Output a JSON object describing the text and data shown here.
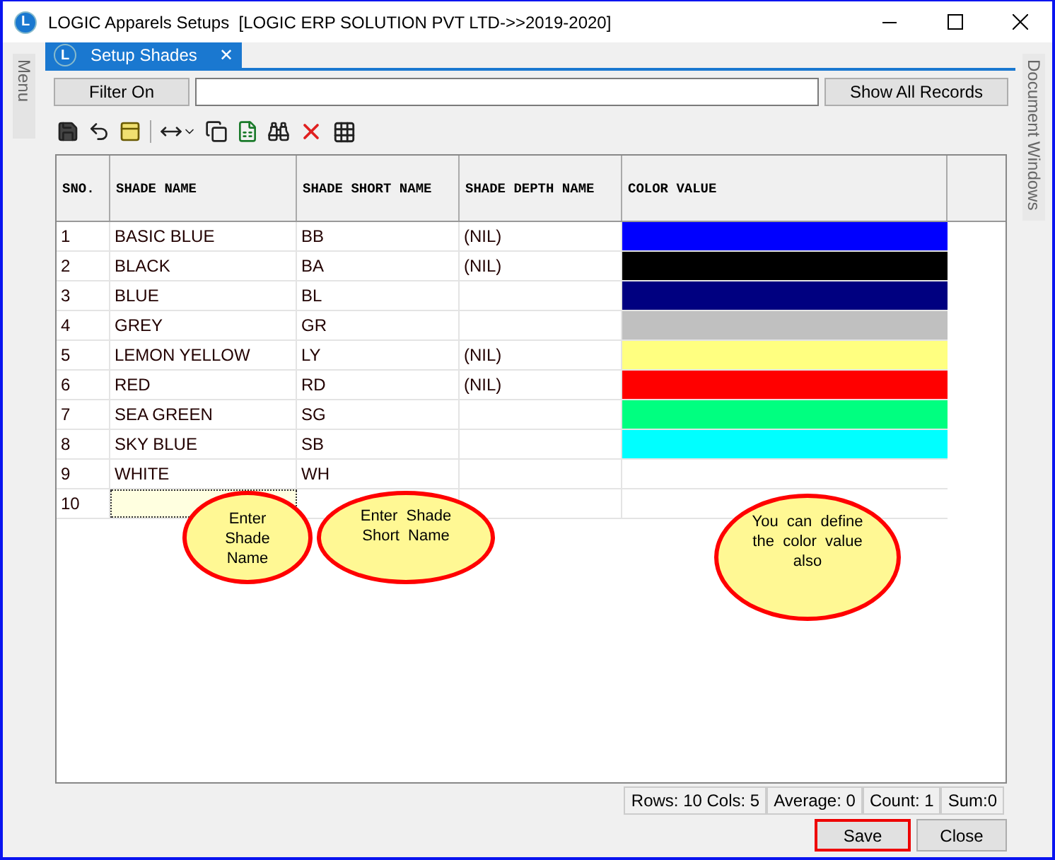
{
  "window": {
    "icon_letter": "L",
    "title": "LOGIC Apparels Setups  [LOGIC ERP SOLUTION PVT LTD->>2019-2020]"
  },
  "side_panels": {
    "left": "Menu",
    "right": "Document Windows"
  },
  "tabs": [
    {
      "icon_letter": "L",
      "label": "Setup Shades",
      "selected": true,
      "close": "✕"
    }
  ],
  "filter": {
    "label": "Filter On",
    "button": "Show All Records"
  },
  "table": {
    "columns": [
      "SNO.",
      "SHADE NAME",
      "SHADE SHORT NAME",
      "SHADE DEPTH NAME",
      "COLOR VALUE"
    ],
    "rows": [
      {
        "sno": "1",
        "name": "BASIC BLUE",
        "short": "BB",
        "depth": "(NIL)",
        "color": "#0000ff",
        "active": false
      },
      {
        "sno": "2",
        "name": "BLACK",
        "short": "BA",
        "depth": "(NIL)",
        "color": "#000000",
        "active": false
      },
      {
        "sno": "3",
        "name": "BLUE",
        "short": "BL",
        "color": "#000080",
        "active": false
      },
      {
        "sno": "4",
        "name": "GREY",
        "short": "GR",
        "color": "#c0c0c0",
        "active": false
      },
      {
        "sno": "5",
        "name": "LEMON YELLOW",
        "short": "LY",
        "depth": "(NIL)",
        "color": "#ffff80",
        "active": false
      },
      {
        "sno": "6",
        "name": "RED",
        "short": "RD",
        "depth": "(NIL)",
        "color": "#ff0000",
        "active": false
      },
      {
        "sno": "7",
        "name": "SEA GREEN",
        "short": "SG",
        "color": "#00ff80",
        "active": false
      },
      {
        "sno": "8",
        "name": "SKY BLUE",
        "short": "SB",
        "color": "#00ffff",
        "active": false
      },
      {
        "sno": "9",
        "name": "WHITE",
        "short": "WH",
        "active": false
      },
      {
        "sno": "10",
        "active": true
      }
    ]
  },
  "callouts": [
    "Enter  Shade Name",
    "Enter  Shade Short  Name",
    "You  can  define the  color  value also"
  ],
  "status_bar": [
    "Rows: 10  Cols: 5",
    "Average: 0",
    "Count: 1",
    "Sum:0"
  ],
  "buttons": [
    {
      "label": "Save",
      "focused": true
    },
    {
      "label": "Close",
      "focused": false
    }
  ]
}
